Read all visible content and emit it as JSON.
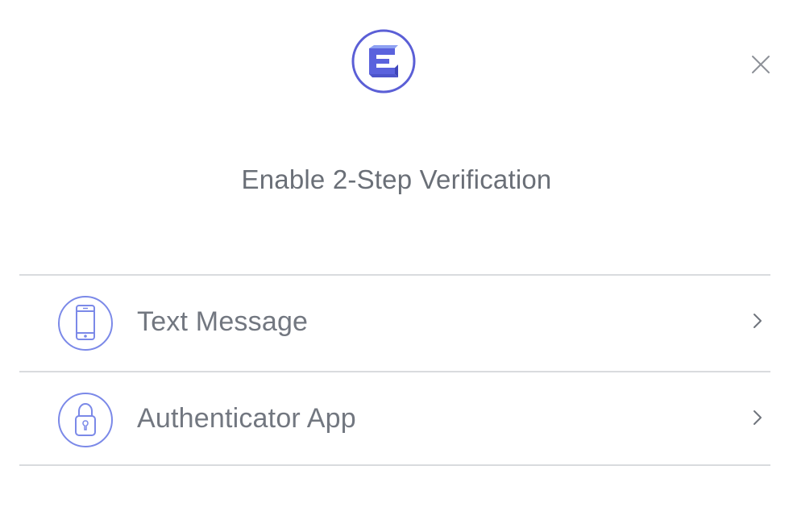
{
  "dialog": {
    "title": "Enable 2-Step Verification",
    "logo_icon": "brand-e-logo",
    "close_icon": "close-icon",
    "options": [
      {
        "label": "Text Message",
        "icon": "phone-icon"
      },
      {
        "label": "Authenticator App",
        "icon": "lock-icon"
      }
    ],
    "chevron_icon": "chevron-right-icon"
  },
  "colors": {
    "brand_primary": "#5b5fd6",
    "brand_light": "#7b89e8",
    "text": "#6f747c",
    "divider": "#d9dbde",
    "icon_gray": "#8d9198"
  }
}
